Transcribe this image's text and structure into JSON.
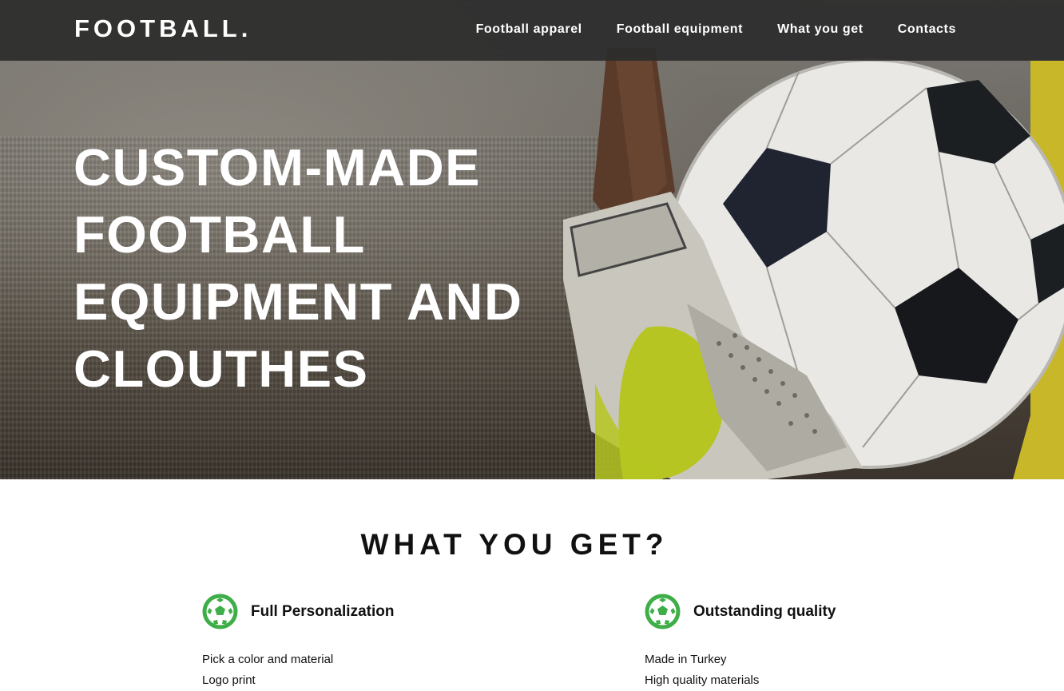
{
  "brand": {
    "logo": "FOOTBALL."
  },
  "nav": {
    "items": [
      {
        "label": "Football apparel"
      },
      {
        "label": "Football equipment"
      },
      {
        "label": "What you get"
      },
      {
        "label": "Contacts"
      }
    ]
  },
  "hero": {
    "title": "CUSTOM-MADE FOOTBALL EQUIPMENT AND CLOUTHES"
  },
  "what_you_get": {
    "title": "WHAT YOU GET?",
    "features": [
      {
        "icon": "soccer-ball-icon",
        "title": "Full Personalization",
        "items": [
          "Pick a color and material",
          "Logo print"
        ]
      },
      {
        "icon": "soccer-ball-icon",
        "title": "Outstanding quality",
        "items": [
          "Made in Turkey",
          "High quality materials"
        ]
      }
    ]
  },
  "colors": {
    "accent_green": "#3fae49",
    "nav_bg": "#2c2c2c",
    "text_dark": "#111111"
  }
}
